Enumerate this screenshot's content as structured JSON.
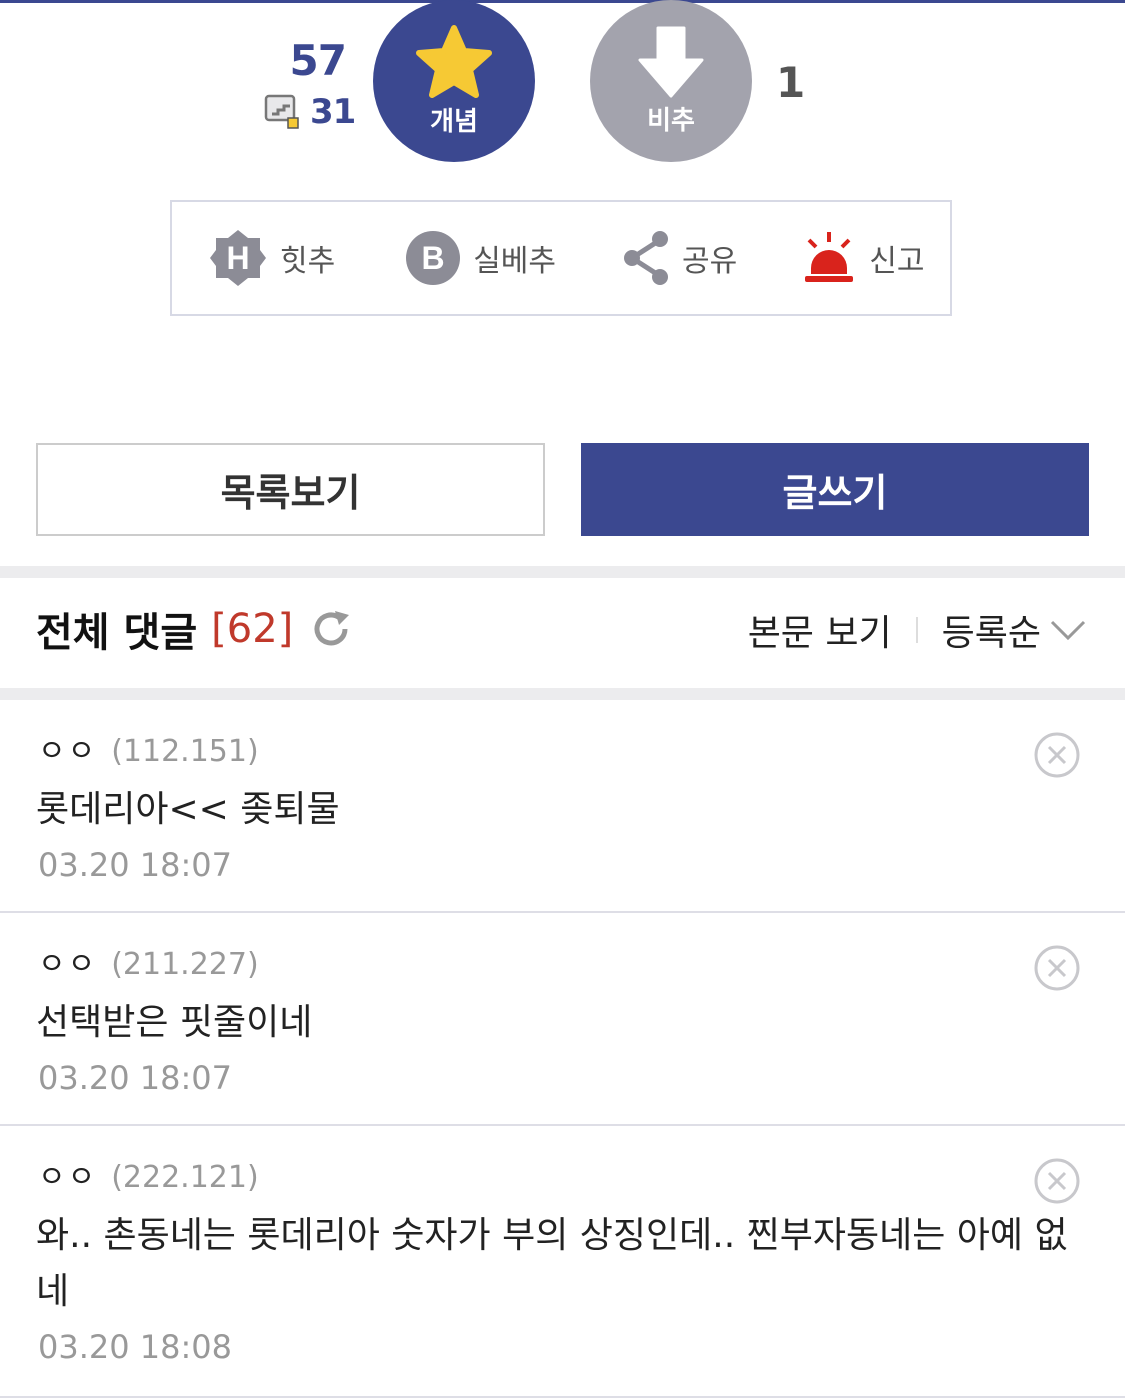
{
  "vote": {
    "up_count": "57",
    "fixed_count": "31",
    "up_label": "개념",
    "down_label": "비추",
    "down_count": "1"
  },
  "actions": [
    {
      "label": "힛추",
      "icon": "hit-icon"
    },
    {
      "label": "실베추",
      "icon": "best-icon"
    },
    {
      "label": "공유",
      "icon": "share-icon"
    },
    {
      "label": "신고",
      "icon": "siren-icon"
    }
  ],
  "buttons": {
    "list": "목록보기",
    "write": "글쓰기"
  },
  "comments_header": {
    "title": "전체 댓글",
    "count": "[62]",
    "view_body": "본문 보기",
    "sort": "등록순"
  },
  "comments": [
    {
      "name": "ㅇㅇ",
      "ip": "(112.151)",
      "text": "롯데리아<< 좆퇴물",
      "date": "03.20 18:07"
    },
    {
      "name": "ㅇㅇ",
      "ip": "(211.227)",
      "text": "선택받은 핏줄이네",
      "date": "03.20 18:07"
    },
    {
      "name": "ㅇㅇ",
      "ip": "(222.121)",
      "text": "와.. 촌동네는 롯데리아 숫자가 부의 상징인데.. 찐부자동네는 아예 없네",
      "date": "03.20 18:08"
    }
  ],
  "colors": {
    "brand": "#3b4890",
    "downvote": "#a3a3ad",
    "count_red": "#c0392b",
    "siren_red": "#d9231c",
    "star_yellow": "#f6c934"
  }
}
